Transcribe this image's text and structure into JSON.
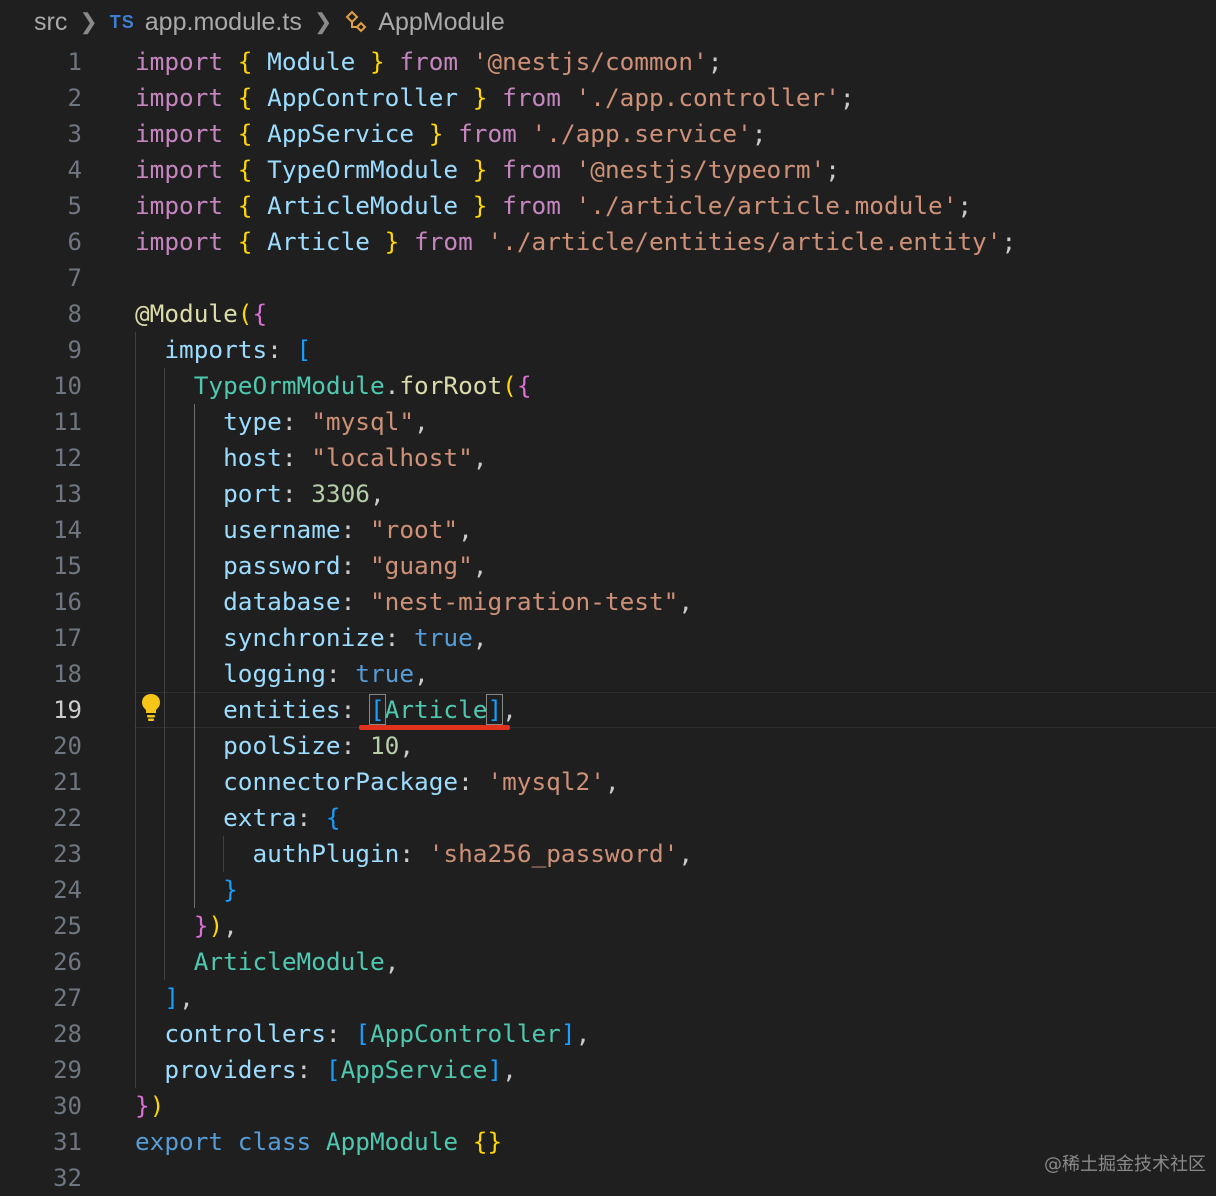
{
  "breadcrumb": {
    "folder": "src",
    "lang_badge": "TS",
    "file": "app.module.ts",
    "symbol": "AppModule"
  },
  "lines": [
    {
      "n": "1",
      "t": [
        [
          "kw",
          "import "
        ],
        [
          "br1",
          "{ "
        ],
        [
          "var",
          "Module "
        ],
        [
          "br1",
          "} "
        ],
        [
          "kw",
          "from "
        ],
        [
          "str",
          "'@nestjs/common'"
        ],
        [
          "pun",
          ";"
        ]
      ]
    },
    {
      "n": "2",
      "t": [
        [
          "kw",
          "import "
        ],
        [
          "br1",
          "{ "
        ],
        [
          "var",
          "AppController "
        ],
        [
          "br1",
          "} "
        ],
        [
          "kw",
          "from "
        ],
        [
          "str",
          "'./app.controller'"
        ],
        [
          "pun",
          ";"
        ]
      ]
    },
    {
      "n": "3",
      "t": [
        [
          "kw",
          "import "
        ],
        [
          "br1",
          "{ "
        ],
        [
          "var",
          "AppService "
        ],
        [
          "br1",
          "} "
        ],
        [
          "kw",
          "from "
        ],
        [
          "str",
          "'./app.service'"
        ],
        [
          "pun",
          ";"
        ]
      ]
    },
    {
      "n": "4",
      "t": [
        [
          "kw",
          "import "
        ],
        [
          "br1",
          "{ "
        ],
        [
          "var",
          "TypeOrmModule "
        ],
        [
          "br1",
          "} "
        ],
        [
          "kw",
          "from "
        ],
        [
          "str",
          "'@nestjs/typeorm'"
        ],
        [
          "pun",
          ";"
        ]
      ]
    },
    {
      "n": "5",
      "t": [
        [
          "kw",
          "import "
        ],
        [
          "br1",
          "{ "
        ],
        [
          "var",
          "ArticleModule "
        ],
        [
          "br1",
          "} "
        ],
        [
          "kw",
          "from "
        ],
        [
          "str",
          "'./article/article.module'"
        ],
        [
          "pun",
          ";"
        ]
      ]
    },
    {
      "n": "6",
      "t": [
        [
          "kw",
          "import "
        ],
        [
          "br1",
          "{ "
        ],
        [
          "var",
          "Article "
        ],
        [
          "br1",
          "} "
        ],
        [
          "kw",
          "from "
        ],
        [
          "str",
          "'./article/entities/article.entity'"
        ],
        [
          "pun",
          ";"
        ]
      ]
    },
    {
      "n": "7",
      "t": []
    },
    {
      "n": "8",
      "t": [
        [
          "fn",
          "@Module"
        ],
        [
          "br1",
          "("
        ],
        [
          "br2",
          "{"
        ]
      ]
    },
    {
      "n": "9",
      "t": [
        [
          "pun",
          "  "
        ],
        [
          "var",
          "imports"
        ],
        [
          "pun",
          ": "
        ],
        [
          "br3",
          "["
        ]
      ]
    },
    {
      "n": "10",
      "t": [
        [
          "pun",
          "    "
        ],
        [
          "type",
          "TypeOrmModule"
        ],
        [
          "pun",
          "."
        ],
        [
          "fn",
          "forRoot"
        ],
        [
          "br1",
          "("
        ],
        [
          "br2",
          "{"
        ]
      ]
    },
    {
      "n": "11",
      "t": [
        [
          "pun",
          "      "
        ],
        [
          "var",
          "type"
        ],
        [
          "pun",
          ": "
        ],
        [
          "str",
          "\"mysql\""
        ],
        [
          "pun",
          ","
        ]
      ]
    },
    {
      "n": "12",
      "t": [
        [
          "pun",
          "      "
        ],
        [
          "var",
          "host"
        ],
        [
          "pun",
          ": "
        ],
        [
          "str",
          "\"localhost\""
        ],
        [
          "pun",
          ","
        ]
      ]
    },
    {
      "n": "13",
      "t": [
        [
          "pun",
          "      "
        ],
        [
          "var",
          "port"
        ],
        [
          "pun",
          ": "
        ],
        [
          "num",
          "3306"
        ],
        [
          "pun",
          ","
        ]
      ]
    },
    {
      "n": "14",
      "t": [
        [
          "pun",
          "      "
        ],
        [
          "var",
          "username"
        ],
        [
          "pun",
          ": "
        ],
        [
          "str",
          "\"root\""
        ],
        [
          "pun",
          ","
        ]
      ]
    },
    {
      "n": "15",
      "t": [
        [
          "pun",
          "      "
        ],
        [
          "var",
          "password"
        ],
        [
          "pun",
          ": "
        ],
        [
          "str",
          "\"guang\""
        ],
        [
          "pun",
          ","
        ]
      ]
    },
    {
      "n": "16",
      "t": [
        [
          "pun",
          "      "
        ],
        [
          "var",
          "database"
        ],
        [
          "pun",
          ": "
        ],
        [
          "str",
          "\"nest-migration-test\""
        ],
        [
          "pun",
          ","
        ]
      ]
    },
    {
      "n": "17",
      "t": [
        [
          "pun",
          "      "
        ],
        [
          "var",
          "synchronize"
        ],
        [
          "pun",
          ": "
        ],
        [
          "kwb",
          "true"
        ],
        [
          "pun",
          ","
        ]
      ]
    },
    {
      "n": "18",
      "t": [
        [
          "pun",
          "      "
        ],
        [
          "var",
          "logging"
        ],
        [
          "pun",
          ": "
        ],
        [
          "kwb",
          "true"
        ],
        [
          "pun",
          ","
        ]
      ]
    },
    {
      "n": "19",
      "t": [
        [
          "pun",
          "      "
        ],
        [
          "var",
          "entities"
        ],
        [
          "pun",
          ": "
        ],
        [
          "br3 bracket-hl",
          "["
        ],
        [
          "type",
          "Article"
        ],
        [
          "br3 bracket-hl",
          "]"
        ],
        [
          "pun",
          ","
        ]
      ]
    },
    {
      "n": "20",
      "t": [
        [
          "pun",
          "      "
        ],
        [
          "var",
          "poolSize"
        ],
        [
          "pun",
          ": "
        ],
        [
          "num",
          "10"
        ],
        [
          "pun",
          ","
        ]
      ]
    },
    {
      "n": "21",
      "t": [
        [
          "pun",
          "      "
        ],
        [
          "var",
          "connectorPackage"
        ],
        [
          "pun",
          ": "
        ],
        [
          "str",
          "'mysql2'"
        ],
        [
          "pun",
          ","
        ]
      ]
    },
    {
      "n": "22",
      "t": [
        [
          "pun",
          "      "
        ],
        [
          "var",
          "extra"
        ],
        [
          "pun",
          ": "
        ],
        [
          "br3",
          "{"
        ]
      ]
    },
    {
      "n": "23",
      "t": [
        [
          "pun",
          "        "
        ],
        [
          "var",
          "authPlugin"
        ],
        [
          "pun",
          ": "
        ],
        [
          "str",
          "'sha256_password'"
        ],
        [
          "pun",
          ","
        ]
      ]
    },
    {
      "n": "24",
      "t": [
        [
          "pun",
          "      "
        ],
        [
          "br3",
          "}"
        ]
      ]
    },
    {
      "n": "25",
      "t": [
        [
          "pun",
          "    "
        ],
        [
          "br2",
          "}"
        ],
        [
          "br1",
          ")"
        ],
        [
          "pun",
          ","
        ]
      ]
    },
    {
      "n": "26",
      "t": [
        [
          "pun",
          "    "
        ],
        [
          "type",
          "ArticleModule"
        ],
        [
          "pun",
          ","
        ]
      ]
    },
    {
      "n": "27",
      "t": [
        [
          "pun",
          "  "
        ],
        [
          "br3",
          "]"
        ],
        [
          "pun",
          ","
        ]
      ]
    },
    {
      "n": "28",
      "t": [
        [
          "pun",
          "  "
        ],
        [
          "var",
          "controllers"
        ],
        [
          "pun",
          ": "
        ],
        [
          "br3",
          "["
        ],
        [
          "type",
          "AppController"
        ],
        [
          "br3",
          "]"
        ],
        [
          "pun",
          ","
        ]
      ]
    },
    {
      "n": "29",
      "t": [
        [
          "pun",
          "  "
        ],
        [
          "var",
          "providers"
        ],
        [
          "pun",
          ": "
        ],
        [
          "br3",
          "["
        ],
        [
          "type",
          "AppService"
        ],
        [
          "br3",
          "]"
        ],
        [
          "pun",
          ","
        ]
      ]
    },
    {
      "n": "30",
      "t": [
        [
          "br2",
          "}"
        ],
        [
          "br1",
          ")"
        ]
      ]
    },
    {
      "n": "31",
      "t": [
        [
          "kwb",
          "export "
        ],
        [
          "kwb",
          "class "
        ],
        [
          "type",
          "AppModule "
        ],
        [
          "br1",
          "{}"
        ]
      ]
    },
    {
      "n": "32",
      "t": []
    }
  ],
  "active_line": "19",
  "watermark": "@稀土掘金技术社区",
  "colors": {
    "background": "#1f1f1f",
    "keyword": "#c586c0",
    "string": "#ce9178",
    "variable": "#9cdcfe",
    "type": "#4ec9b0",
    "underline": "#e0321c"
  }
}
